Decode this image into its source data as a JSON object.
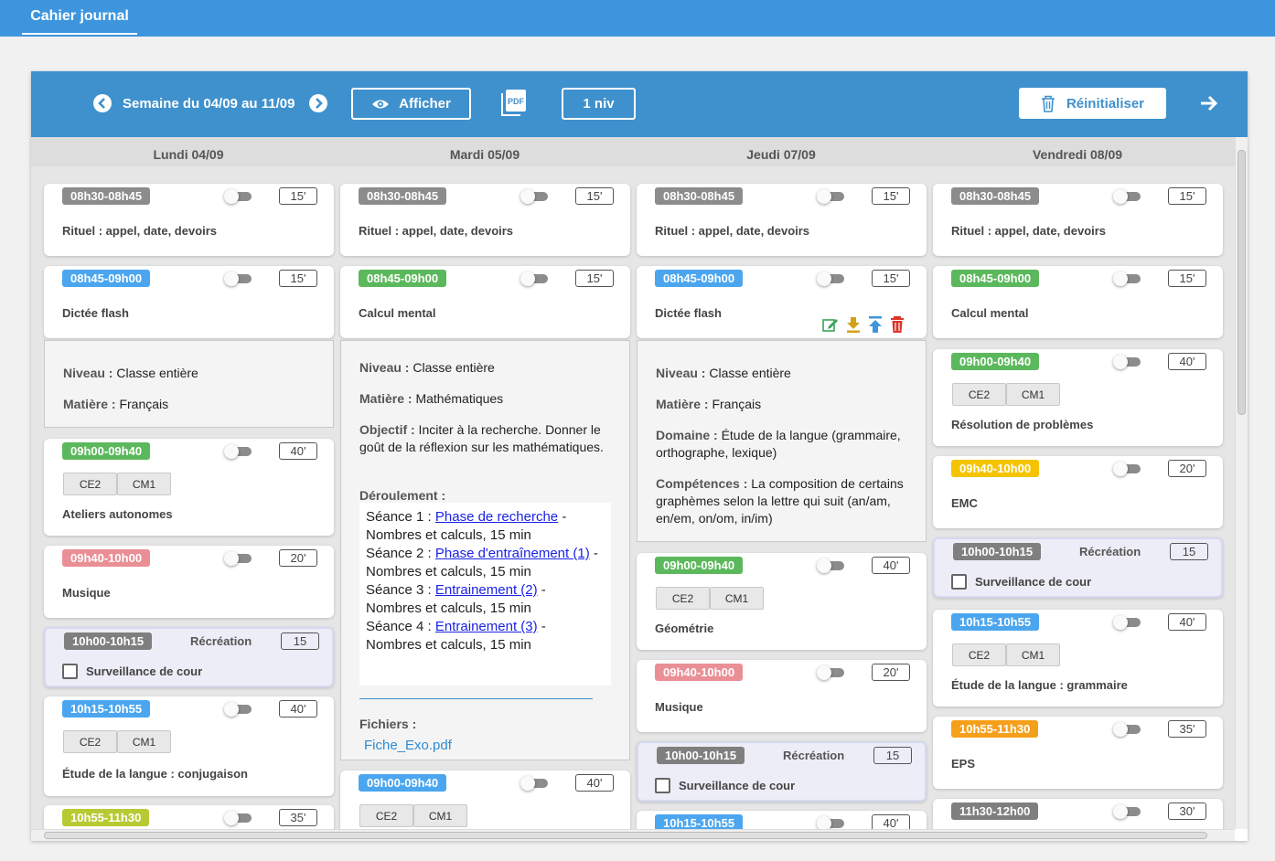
{
  "app": {
    "title": "Cahier journal"
  },
  "toolbar": {
    "week_label": "Semaine du 04/09 au 11/09",
    "show_label": "Afficher",
    "pdf_label": "PDF",
    "level_label": "1 niv",
    "reset_label": "Réinitialiser"
  },
  "colors": {
    "grey": "#8c8c8c",
    "blue": "#4ba6ef",
    "green": "#5cb85c",
    "pink": "#e98f95",
    "olive": "#b7ca33",
    "yellow": "#f5c400",
    "orange": "#f5a01a",
    "darkgrey": "#7f7f7f"
  },
  "days": [
    {
      "label": "Lundi 04/09"
    },
    {
      "label": "Mardi 05/09"
    },
    {
      "label": "Jeudi 07/09"
    },
    {
      "label": "Vendredi 08/09"
    }
  ],
  "monday": {
    "c1": {
      "time": "08h30-08h45",
      "dur": "15'",
      "title": "Rituel : appel, date, devoirs"
    },
    "c2": {
      "time": "08h45-09h00",
      "dur": "15'",
      "title": "Dictée flash"
    },
    "d": {
      "niveau_k": "Niveau :",
      "niveau_v": " Classe entière",
      "matiere_k": "Matière :",
      "matiere_v": " Français"
    },
    "c3": {
      "time": "09h00-09h40",
      "dur": "40'",
      "lv1": "CE2",
      "lv2": "CM1",
      "title": "Ateliers autonomes"
    },
    "c4": {
      "time": "09h40-10h00",
      "dur": "20'",
      "title": "Musique"
    },
    "r": {
      "time": "10h00-10h15",
      "label": "Récréation",
      "dur": "15",
      "check": "Surveillance de cour"
    },
    "c5": {
      "time": "10h15-10h55",
      "dur": "40'",
      "lv1": "CE2",
      "lv2": "CM1",
      "title": "Étude de la langue : conjugaison"
    },
    "c6": {
      "time": "10h55-11h30",
      "dur": "35'"
    }
  },
  "tuesday": {
    "c1": {
      "time": "08h30-08h45",
      "dur": "15'",
      "title": "Rituel : appel, date, devoirs"
    },
    "c2": {
      "time": "08h45-09h00",
      "dur": "15'",
      "title": "Calcul mental"
    },
    "d": {
      "niveau_k": "Niveau :",
      "niveau_v": " Classe entière",
      "matiere_k": "Matière :",
      "matiere_v": " Mathématiques",
      "objectif_k": "Objectif :",
      "objectif_v": " Inciter à la recherche. Donner le goût de la réflexion sur les mathématiques.",
      "deroul_k": "Déroulement :",
      "s1_pre": "Séance 1 : ",
      "s1_link": "Phase de recherche",
      "s1_post": " - Nombres et calculs, 15 min",
      "s2_pre": "Séance 2 : ",
      "s2_link": "Phase d'entraînement (1)",
      "s2_post": " - Nombres et calculs, 15 min",
      "s3_pre": "Séance 3 : ",
      "s3_link": "Entrainement (2)",
      "s3_post": " - Nombres et calculs, 15 min",
      "s4_pre": "Séance 4 : ",
      "s4_link": "Entrainement (3)",
      "s4_post": " - Nombres et calculs, 15 min",
      "fichiers_k": "Fichiers :",
      "file": "Fiche_Exo.pdf"
    },
    "c3": {
      "time": "09h00-09h40",
      "dur": "40'",
      "lv1": "CE2",
      "lv2": "CM1"
    }
  },
  "thursday": {
    "c1": {
      "time": "08h30-08h45",
      "dur": "15'",
      "title": "Rituel : appel, date, devoirs"
    },
    "c2": {
      "time": "08h45-09h00",
      "dur": "15'",
      "title": "Dictée flash"
    },
    "d": {
      "niveau_k": "Niveau :",
      "niveau_v": " Classe entière",
      "matiere_k": "Matière :",
      "matiere_v": " Français",
      "domaine_k": "Domaine :",
      "domaine_v": " Étude de la langue (grammaire, orthographe, lexique)",
      "comp_k": "Compétences :",
      "comp_v": " La composition de certains graphèmes selon la lettre qui suit  (an/am, en/em, on/om, in/im)"
    },
    "c3": {
      "time": "09h00-09h40",
      "dur": "40'",
      "lv1": "CE2",
      "lv2": "CM1",
      "title": "Géométrie"
    },
    "c4": {
      "time": "09h40-10h00",
      "dur": "20'",
      "title": "Musique"
    },
    "r": {
      "time": "10h00-10h15",
      "label": "Récréation",
      "dur": "15",
      "check": "Surveillance de cour"
    },
    "c5": {
      "time": "10h15-10h55",
      "dur": "40'"
    }
  },
  "friday": {
    "c1": {
      "time": "08h30-08h45",
      "dur": "15'",
      "title": "Rituel : appel, date, devoirs"
    },
    "c2": {
      "time": "08h45-09h00",
      "dur": "15'",
      "title": "Calcul mental"
    },
    "c3": {
      "time": "09h00-09h40",
      "dur": "40'",
      "lv1": "CE2",
      "lv2": "CM1",
      "title": "Résolution de problèmes"
    },
    "c4": {
      "time": "09h40-10h00",
      "dur": "20'",
      "title": "EMC"
    },
    "r": {
      "time": "10h00-10h15",
      "label": "Récréation",
      "dur": "15",
      "check": "Surveillance de cour"
    },
    "c5": {
      "time": "10h15-10h55",
      "dur": "40'",
      "lv1": "CE2",
      "lv2": "CM1",
      "title": "Étude de la langue : grammaire"
    },
    "c6": {
      "time": "10h55-11h30",
      "dur": "35'",
      "title": "EPS"
    },
    "c7": {
      "time": "11h30-12h00",
      "dur": "30'"
    }
  }
}
